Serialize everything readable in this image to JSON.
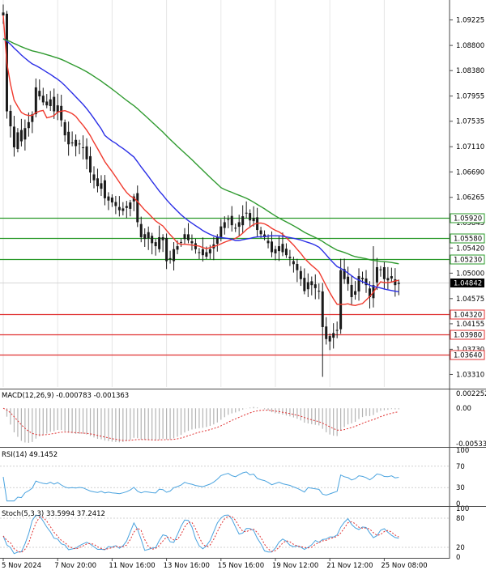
{
  "colors": {
    "background": "#ffffff",
    "grid": "#e6e6e6",
    "frame": "#4a4a4a",
    "candle": "#1a1a1a",
    "ma_fast": "#f03a2e",
    "ma_mid": "#2a2ee6",
    "ma_slow": "#2f9a2f",
    "resistance": "#2a9a2a",
    "support": "#e03030",
    "current_price_bg": "#000000",
    "indicator_line": "#4aa3df",
    "signal_line": "#e03030",
    "histogram": "#b3b3b3"
  },
  "chart_data": {
    "type": "candlestick",
    "symbol": "",
    "price_axis": {
      "ylim": [
        1.031,
        1.0945
      ],
      "ticks": [
        "1.09225",
        "1.08800",
        "1.08380",
        "1.07955",
        "1.07535",
        "1.07110",
        "1.06690",
        "1.06265",
        "1.05845",
        "1.05420",
        "1.05000",
        "1.04575",
        "1.04155",
        "1.03730",
        "1.03310"
      ]
    },
    "time_axis": {
      "labels": [
        "5 Nov 2024",
        "7 Nov 20:00",
        "11 Nov 16:00",
        "13 Nov 16:00",
        "15 Nov 16:00",
        "19 Nov 12:00",
        "21 Nov 12:00",
        "25 Nov 08:00"
      ],
      "label_bars": [
        0,
        15,
        30,
        45,
        60,
        75,
        90,
        105
      ]
    },
    "current_price": "1.04842",
    "horizontal_levels": [
      {
        "label": "1.05920",
        "price": 1.0592,
        "kind": "resistance"
      },
      {
        "label": "1.05580",
        "price": 1.0558,
        "kind": "resistance"
      },
      {
        "label": "1.05230",
        "price": 1.0523,
        "kind": "resistance"
      },
      {
        "label": "1.04320",
        "price": 1.0432,
        "kind": "support"
      },
      {
        "label": "1.03980",
        "price": 1.0398,
        "kind": "support"
      },
      {
        "label": "1.03640",
        "price": 1.0364,
        "kind": "support"
      }
    ],
    "closes": [
      1.093,
      1.077,
      1.0745,
      1.071,
      1.0735,
      1.072,
      1.0742,
      1.0752,
      1.0765,
      1.081,
      1.0795,
      1.0785,
      1.078,
      1.079,
      1.077,
      1.078,
      1.0755,
      1.073,
      1.0715,
      1.0718,
      1.0712,
      1.0715,
      1.071,
      1.069,
      1.0668,
      1.0655,
      1.0645,
      1.065,
      1.0625,
      1.0628,
      1.0618,
      1.0612,
      1.0605,
      1.0608,
      1.0612,
      1.0618,
      1.0628,
      1.0585,
      1.056,
      1.0565,
      1.0558,
      1.055,
      1.0545,
      1.056,
      1.0555,
      1.052,
      1.0525,
      1.054,
      1.0545,
      1.0552,
      1.0565,
      1.0555,
      1.055,
      1.054,
      1.0535,
      1.053,
      1.0535,
      1.054,
      1.0548,
      1.056,
      1.0578,
      1.0585,
      1.059,
      1.058,
      1.0575,
      1.0585,
      1.0595,
      1.06,
      1.0588,
      1.0592,
      1.0572,
      1.0565,
      1.056,
      1.055,
      1.0535,
      1.054,
      1.0545,
      1.0535,
      1.053,
      1.0525,
      1.0515,
      1.0505,
      1.049,
      1.047,
      1.0485,
      1.048,
      1.0475,
      1.047,
      1.041,
      1.039,
      1.0395,
      1.04,
      1.0405,
      1.0505,
      1.049,
      1.0482,
      1.046,
      1.047,
      1.0495,
      1.049,
      1.048,
      1.046,
      1.048,
      1.051,
      1.0505,
      1.049,
      1.0488,
      1.0495,
      1.048,
      1.0484
    ],
    "ma_periods": [
      20,
      50,
      100
    ],
    "moving_averages_note_hidden": false,
    "macd": {
      "label": "MACD(12,26,9) -0.000783 -0.001363",
      "ylim": [
        -0.0056,
        0.0026
      ],
      "ticks": [
        "0.002252",
        "0.00",
        "-0.005334"
      ]
    },
    "rsi": {
      "label": "RSI(14) 49.1452",
      "ylim": [
        0,
        100
      ],
      "ticks": [
        "100",
        "70",
        "30",
        "0"
      ]
    },
    "stoch": {
      "label": "Stoch(5,3,3) 33.5994 37.2412",
      "ylim": [
        0,
        100
      ],
      "ticks": [
        "100",
        "80",
        "20",
        "0"
      ]
    }
  }
}
